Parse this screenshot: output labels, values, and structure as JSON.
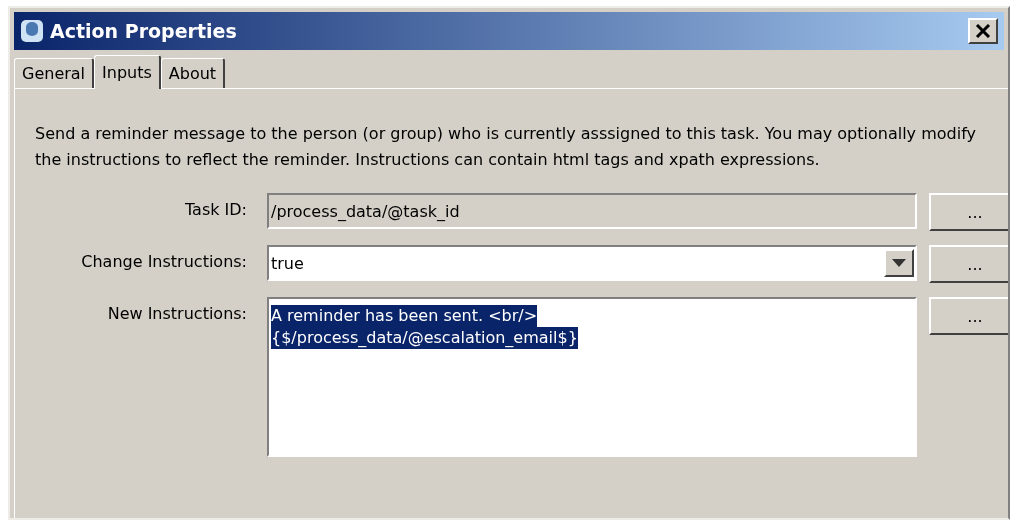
{
  "window": {
    "title": "Action Properties"
  },
  "tabs": [
    {
      "label": "General",
      "selected": false
    },
    {
      "label": "Inputs",
      "selected": true
    },
    {
      "label": "About",
      "selected": false
    }
  ],
  "description": "Send a reminder message to the person (or group) who is currently asssigned to this task. You may optionally modify the instructions to reflect the reminder. Instructions can contain html tags and xpath expressions.",
  "fields": [
    {
      "kind": "readonly",
      "label": "Task ID:",
      "value_lines": [
        "/process_data/@task_id"
      ],
      "selected": false,
      "button": "..."
    },
    {
      "kind": "dropdown",
      "label": "Change Instructions:",
      "value_lines": [
        "true"
      ],
      "selected": false,
      "button": "..."
    },
    {
      "kind": "textarea",
      "label": "New Instructions:",
      "value_lines": [
        "A reminder has been sent. <br/>",
        "{$/process_data/@escalation_email$}"
      ],
      "selected": true,
      "button": "..."
    }
  ]
}
